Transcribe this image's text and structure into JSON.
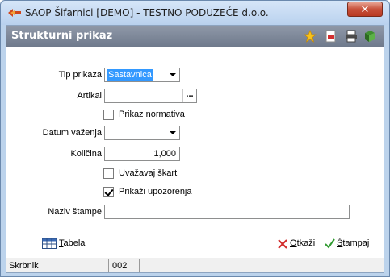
{
  "window": {
    "title": "SAOP Šifarnici [DEMO] - TESTNO PODUZEĆE d.o.o.",
    "close_label": "✕"
  },
  "form": {
    "title": "Strukturni prikaz",
    "header_icons": [
      "star-icon",
      "pdf-icon",
      "print-icon",
      "book-icon"
    ]
  },
  "fields": {
    "tip_prikaza": {
      "label": "Tip prikaza",
      "value": "Sastavnica"
    },
    "artikal": {
      "label": "Artikal",
      "value": "",
      "button_label": "..."
    },
    "prikaz_normativa": {
      "label": "Prikaz normativa",
      "checked": false
    },
    "datum_vazenja": {
      "label": "Datum važenja",
      "value": ""
    },
    "kolicina": {
      "label": "Količina",
      "value": "1,000"
    },
    "uvazavaj_skart": {
      "label": "Uvažavaj škart",
      "checked": false
    },
    "prikazi_upozorenja": {
      "label": "Prikaži upozorenja",
      "checked": true
    },
    "naziv_stampe": {
      "label": "Naziv štampe",
      "value": ""
    }
  },
  "buttons": {
    "tabela": {
      "underlined": "T",
      "rest": "abela"
    },
    "otkazi": {
      "underlined": "O",
      "rest": "tkaži"
    },
    "stampaj": {
      "underlined": "Š",
      "rest": "tampaj"
    }
  },
  "status": {
    "user": "Skrbnik",
    "code": "002"
  },
  "colors": {
    "selection": "#3399ff",
    "header": "#7f899b",
    "cancel_x": "#d22c2c",
    "confirm_check": "#2f9a2f"
  }
}
